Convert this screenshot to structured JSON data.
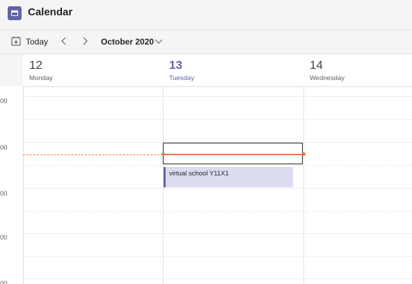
{
  "header": {
    "title": "Calendar",
    "app_icon": "calendar-app-icon",
    "accent_color": "#6264a7"
  },
  "toolbar": {
    "today_label": "Today",
    "today_icon": "calendar-today-icon",
    "prev_icon": "chevron-left-icon",
    "next_icon": "chevron-right-icon",
    "month_label": "October 2020",
    "month_dropdown_icon": "chevron-down-icon"
  },
  "days": [
    {
      "number": "12",
      "name": "Monday",
      "is_today": false
    },
    {
      "number": "13",
      "name": "Tuesday",
      "is_today": true
    },
    {
      "number": "14",
      "name": "Wednesday",
      "is_today": false
    }
  ],
  "time_labels": [
    "00",
    "00",
    "00",
    "00",
    "00"
  ],
  "events": [
    {
      "title": "virtual school Y11X1",
      "day": "13",
      "color": "#dcdcf0",
      "accent": "#6264a7"
    }
  ],
  "current_time_color": "#e97548"
}
